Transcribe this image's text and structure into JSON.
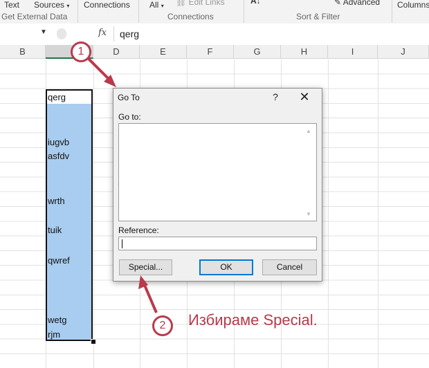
{
  "ribbon": {
    "text_label": "Text",
    "sources_label": "Sources",
    "connections_label": "Connections",
    "all_label": "All",
    "edit_links_label": "Edit Links",
    "advanced_label": "Advanced",
    "columns_label": "Columns",
    "group_external": "Get External Data",
    "group_connections": "Connections",
    "group_sortfilter": "Sort & Filter"
  },
  "formula_bar": {
    "fx": "fx",
    "value": "qerg"
  },
  "columns": [
    "B",
    "",
    "D",
    "E",
    "F",
    "G",
    "H",
    "I",
    "J"
  ],
  "cells": [
    "qerg",
    "iugvb",
    "asfdv",
    "wrth",
    "tuik",
    "qwref",
    "wetg",
    "rjm"
  ],
  "dialog": {
    "title": "Go To",
    "help": "?",
    "close": "✕",
    "goto_label": "Go to:",
    "reference_label": "Reference:",
    "reference_value": "",
    "special_button": "Special...",
    "ok_button": "OK",
    "cancel_button": "Cancel"
  },
  "annotations": {
    "callout1": "1",
    "callout2": "2",
    "caption": "Избираме Special."
  },
  "colors": {
    "accent_red": "#b83a4b",
    "selection_blue": "#a9cdf0",
    "excel_green": "#217346"
  }
}
